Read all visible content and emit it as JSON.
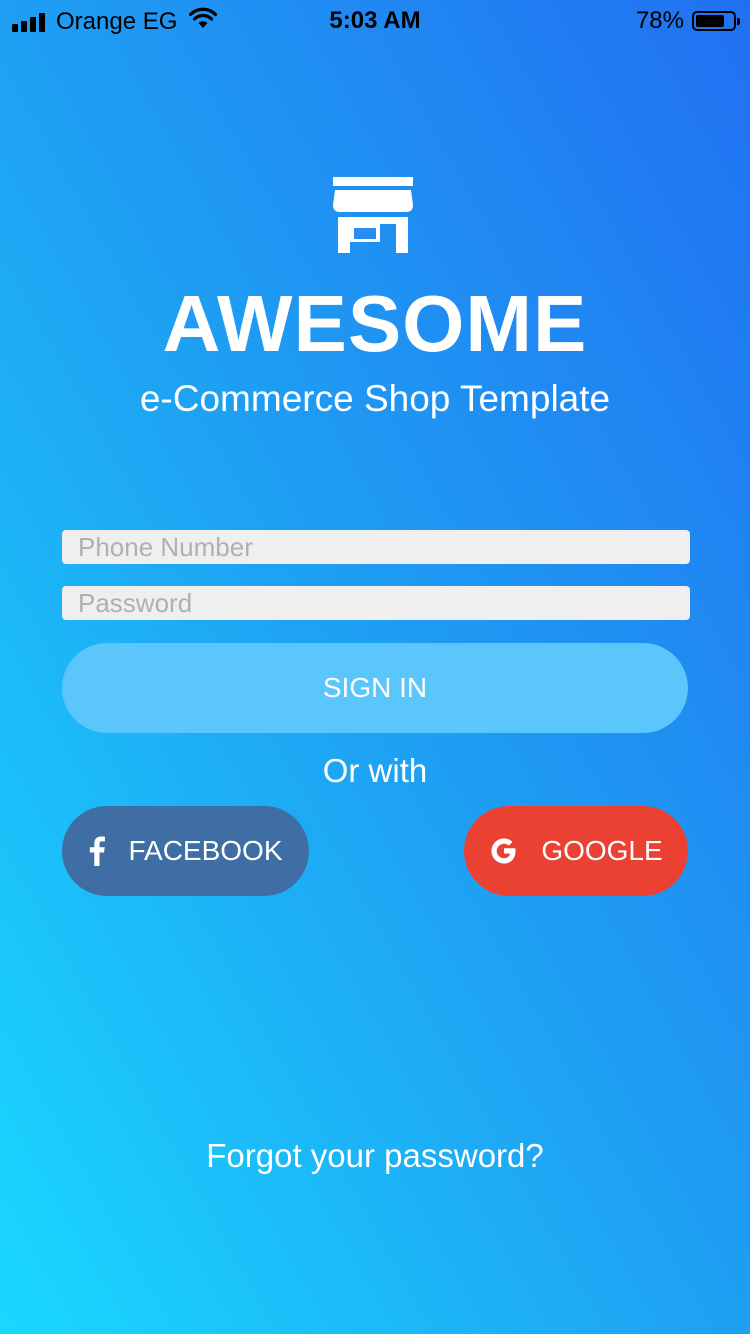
{
  "status_bar": {
    "carrier": "Orange EG",
    "time": "5:03 AM",
    "battery_percent": "78%",
    "battery_level": 0.78,
    "icons": [
      "signal-icon",
      "wifi-icon",
      "battery-icon"
    ]
  },
  "logo": {
    "icon": "storefront-icon",
    "title": "AWESOME",
    "subtitle": "e-Commerce Shop Template"
  },
  "login_form": {
    "phone_placeholder": "Phone Number",
    "phone_value": "",
    "password_placeholder": "Password",
    "password_value": "",
    "sign_in_label": "SIGN IN"
  },
  "social": {
    "or_with_label": "Or with",
    "facebook_label": "FACEBOOK",
    "facebook_icon": "facebook-icon",
    "google_label": "GOOGLE",
    "google_icon": "google-icon"
  },
  "forgot_password_label": "Forgot your password?",
  "colors": {
    "gradient_top": "#2170f2",
    "gradient_bottom": "#19d8ff",
    "sign_in_button": "#5bc6fb",
    "facebook_button": "#3e6ea3",
    "google_button": "#ea4133",
    "input_background": "#efefef"
  }
}
